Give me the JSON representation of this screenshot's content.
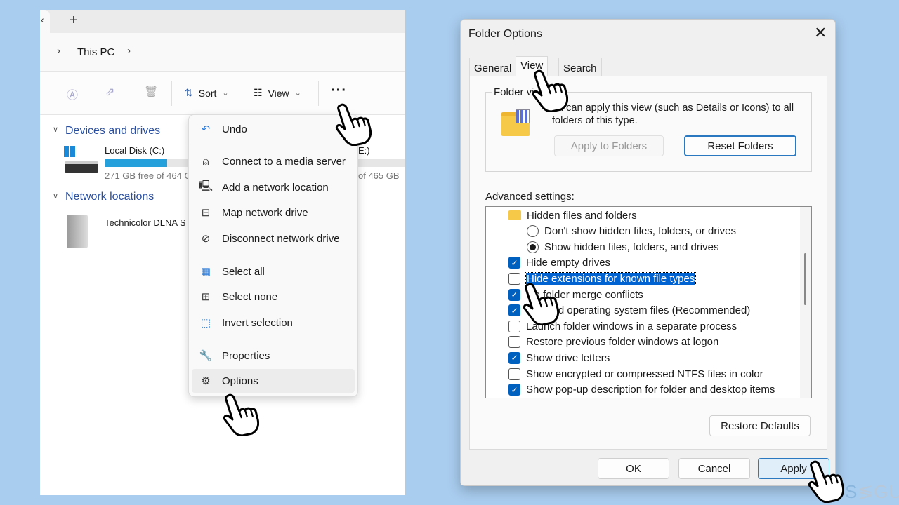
{
  "explorer": {
    "new_tab_icon": "plus-icon",
    "breadcrumb": [
      "This PC"
    ],
    "toolbar": {
      "sort": "Sort",
      "view": "View",
      "more_icon": "ellipsis-icon"
    },
    "sections": {
      "devices": "Devices and drives",
      "network": "Network locations"
    },
    "drives": [
      {
        "name": "Local Disk (C:)",
        "free": "271 GB free of 464 G",
        "used_fraction": 0.42
      },
      {
        "name": "E:)",
        "free": "of 465 GB"
      }
    ],
    "network_items": [
      {
        "name": "Technicolor DLNA S"
      }
    ],
    "menu": [
      {
        "label": "Undo",
        "icon": "undo-icon"
      },
      {
        "label": "Connect to a media server",
        "icon": "media-server-icon"
      },
      {
        "label": "Add a network location",
        "icon": "network-location-icon"
      },
      {
        "label": "Map network drive",
        "icon": "map-drive-icon"
      },
      {
        "label": "Disconnect network drive",
        "icon": "disconnect-drive-icon"
      },
      {
        "label": "Select all",
        "icon": "select-all-icon"
      },
      {
        "label": "Select none",
        "icon": "select-none-icon"
      },
      {
        "label": "Invert selection",
        "icon": "invert-selection-icon"
      },
      {
        "label": "Properties",
        "icon": "wrench-icon"
      },
      {
        "label": "Options",
        "icon": "gear-icon",
        "highlighted": true
      }
    ]
  },
  "dialog": {
    "title": "Folder Options",
    "tabs": [
      "General",
      "View",
      "Search"
    ],
    "active_tab": "View",
    "folder_views": {
      "legend": "Folder vi",
      "description": "ou can apply this view (such as Details or Icons) to all folders of this type.",
      "apply_button": "Apply to Folders",
      "reset_button": "Reset Folders"
    },
    "advanced_label": "Advanced settings:",
    "settings": [
      {
        "type": "folder",
        "label": "Hidden files and folders"
      },
      {
        "type": "radio",
        "label": "Don't show hidden files, folders, or drives",
        "checked": false
      },
      {
        "type": "radio",
        "label": "Show hidden files, folders, and drives",
        "checked": true
      },
      {
        "type": "check",
        "label": "Hide empty drives",
        "checked": true
      },
      {
        "type": "check",
        "label": "Hide extensions for known file types",
        "checked": false,
        "selected": true
      },
      {
        "type": "check",
        "label": "ide folder merge conflicts",
        "checked": true
      },
      {
        "type": "check",
        "label": "rotected operating system files (Recommended)",
        "checked": true
      },
      {
        "type": "check",
        "label": "Launch folder windows in a separate process",
        "checked": false
      },
      {
        "type": "check",
        "label": "Restore previous folder windows at logon",
        "checked": false
      },
      {
        "type": "check",
        "label": "Show drive letters",
        "checked": true
      },
      {
        "type": "check",
        "label": "Show encrypted or compressed NTFS files in color",
        "checked": false
      },
      {
        "type": "check",
        "label": "Show pop-up description for folder and desktop items",
        "checked": true
      }
    ],
    "restore_defaults": "Restore Defaults",
    "ok": "OK",
    "cancel": "Cancel",
    "apply": "Apply"
  },
  "watermark": "PCSEGURO"
}
